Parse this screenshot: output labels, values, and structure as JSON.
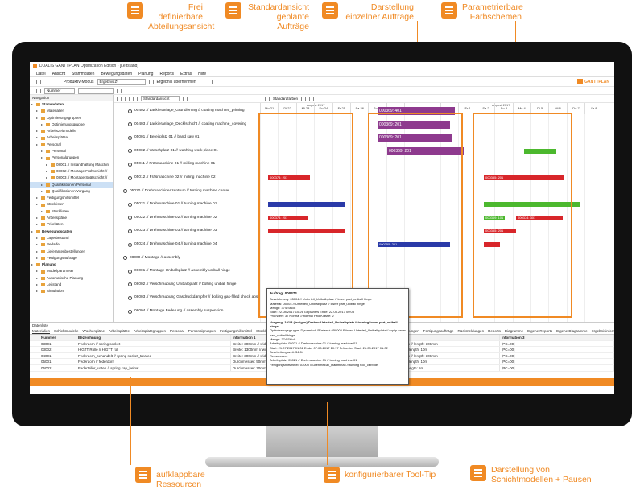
{
  "callouts": {
    "top": [
      {
        "id": "c1",
        "text": "Frei definierbare Abteilungsansicht",
        "icon": "list-icon"
      },
      {
        "id": "c2",
        "text": "Standardansicht geplante Aufträge",
        "icon": "gantt-icon"
      },
      {
        "id": "c3",
        "text": "Darstellung einzelner Aufträge",
        "icon": "order-icon"
      },
      {
        "id": "c4",
        "text": "Parametrierbare Farbschemen",
        "icon": "palette-icon"
      }
    ],
    "bottom": [
      {
        "id": "c5",
        "text": "aufklappbare Ressourcen",
        "icon": "list-icon"
      },
      {
        "id": "c6",
        "text": "konfigurierbarer Tool-Tip",
        "icon": "tooltip-icon"
      },
      {
        "id": "c7",
        "text": "Darstellung von Schichtmodellen + Pausen",
        "icon": "shift-icon"
      }
    ]
  },
  "app": {
    "title": "DUALIS GANTTPLAN Optimization Edition - [Leitstand]",
    "menu": [
      "Datei",
      "Ansicht",
      "Stammdaten",
      "Bewegungsdaten",
      "Planung",
      "Reports",
      "Extras",
      "Hilfe"
    ],
    "mode_label": "Produktiv-Modus",
    "result_value": "Ergebnis Z*",
    "apply_label": "Ergebnis übernehmen",
    "brand": "GANTTPLAN",
    "filter_value": "Nummer",
    "view_value": "Standardansicht",
    "color_value": "Standardfarben"
  },
  "nav": {
    "header": "Navigation",
    "items": [
      {
        "label": "Stammdaten",
        "level": 0,
        "bold": true
      },
      {
        "label": "Materialien",
        "level": 1
      },
      {
        "label": "Optimierungsgruppen",
        "level": 1
      },
      {
        "label": "Optimierungsgruppe",
        "level": 2
      },
      {
        "label": "Arbeitszeitmodelle",
        "level": 1
      },
      {
        "label": "Arbeitsplätze",
        "level": 1
      },
      {
        "label": "Personal",
        "level": 1
      },
      {
        "label": "Personal",
        "level": 2
      },
      {
        "label": "Personalgruppen",
        "level": 2
      },
      {
        "label": "08001 // Instandhaltung Maschin",
        "level": 3
      },
      {
        "label": "08002 // Montage Frühschicht //",
        "level": 3
      },
      {
        "label": "08003 // Montage Spätschicht //",
        "level": 3
      },
      {
        "label": "Qualifikationen Personal",
        "level": 2,
        "selected": true
      },
      {
        "label": "Qualifikationen Vorgang",
        "level": 2
      },
      {
        "label": "Fertigungshilfsmittel",
        "level": 1
      },
      {
        "label": "Stücklisten",
        "level": 1
      },
      {
        "label": "Stücklisten",
        "level": 2
      },
      {
        "label": "Arbeitspläne",
        "level": 1
      },
      {
        "label": "Prioritäten",
        "level": 1
      },
      {
        "label": "Bewegungsdaten",
        "level": 0,
        "bold": true
      },
      {
        "label": "Lagerbestand",
        "level": 1
      },
      {
        "label": "Bedarfe",
        "level": 1
      },
      {
        "label": "Lieferantenbestellungen",
        "level": 1
      },
      {
        "label": "Fertigungsaufträge",
        "level": 1
      },
      {
        "label": "Planung",
        "level": 0,
        "bold": true
      },
      {
        "label": "Modellparameter",
        "level": 1
      },
      {
        "label": "Automatische Planung",
        "level": 1
      },
      {
        "label": "Leitstand",
        "level": 1
      },
      {
        "label": "Simulation",
        "level": 1
      }
    ]
  },
  "resources": [
    {
      "label": "00402 // Lackieranlage_Grundierung // coating machine_priming",
      "group": false
    },
    {
      "label": "00403 // Lackieranlage_Decklschicht // coating machine_covering",
      "group": false
    },
    {
      "label": "05001 // Bereitplatz 01 // band saw 01",
      "group": false
    },
    {
      "label": "05002 // Waschplatz 01 // washing work place 01",
      "group": false
    },
    {
      "label": "05011 // Fräsmaschine 01 // milling machine 01",
      "group": false
    },
    {
      "label": "05012 // Fräsmaschine 02 // milling machine 02",
      "group": false
    },
    {
      "label": "05020 // Drehmaschinenzentrum // turning machine center",
      "group": true
    },
    {
      "label": "05021 // Drehmaschine 01 // turning machine 01",
      "group": false
    },
    {
      "label": "05022 // Drehmaschine 02 // turning machine 02",
      "group": false
    },
    {
      "label": "05023 // Drehmaschine 03 // turning machine 03",
      "group": false
    },
    {
      "label": "05024 // Drehmaschine 04 // turning machine 04",
      "group": false
    },
    {
      "label": "08000 // Montage // assembly",
      "group": true
    },
    {
      "label": "08001 // Montage Unibalbplatz // assembly uniball hinge",
      "group": false
    },
    {
      "label": "08002 // Verschraubung Unibalbplatz // bolting uniball hinge",
      "group": false
    },
    {
      "label": "08003 // Verschraubung Gasdruckdämpfer // bolting gas-filled shock absorber",
      "group": false
    },
    {
      "label": "08004 // Montage Federung // assembly suspension",
      "group": false
    }
  ],
  "timeline": {
    "month": "August 2017",
    "days": [
      "Mo 21",
      "Di 22",
      "Mi 23",
      "Do 24",
      "Fr 25",
      "Sa 26",
      "So 27",
      "Mo 28",
      "Di 29",
      "Mi 30",
      "Do 31",
      "Fr 1",
      "Sa 2",
      "So 3",
      "Mo 4",
      "Di 5",
      "Mi 6",
      "Do 7",
      "Fr 8"
    ]
  },
  "orders": {
    "o1": "000369: 401",
    "o2": "000369: 201",
    "o3": "000369: 201",
    "o4": "000369: 201",
    "o5": "000374: 201",
    "o6": "000355: 201",
    "o7": "000355: 201",
    "o8": "000374: 201",
    "o9": "000369: 101",
    "o10": "000374: 301",
    "o11": "000355: 201",
    "o12": "0003",
    "o13": "000355: 201",
    "o14": "000374: 201",
    "o15": "000355: 201"
  },
  "tooltip": {
    "title": "Auftrag: 000374",
    "lines": [
      "Bezeichnung: 05004 // Unterteil_Unibalbplatz // lower part_uniball hinge",
      "Material: 05004 // Unterteil_Unibalbplatz // lower part_uniball hinge",
      "Menge: 374 Stück",
      "Start: 22.08.2017 10:26 Geplantes Ende: 22.08.2017 00:03",
      "Prio/Wert: 3 / Normal // normal Prio/Klasse: 2"
    ],
    "section": "Vorgang: 101/3 (fertigen) Drehen Unterteil_Unibalbplatz // turning lower part_uniball hinge",
    "lines2": [
      "Optimierungsgruppe: Dynamisch Rüsten + 05000 / Rüsten Unterteil_Unibalbplatz // equip lower part_uniball hinge",
      "Menge: 374 Stück",
      "Arbeitsplatz: 05021 // Drehmaschine 01 // turning machine 01",
      "Start: 21.07.2017 01:02 Ende: 07.08.2017 10:17 Frühester Start: 21.08.2017 01:02 Bearbeitungszeit: 34:04",
      "Ressourcen:",
      "Arbeitsplatz: 05021 // Drehmaschine 01 // turning machine 01",
      "Fertigungshilfsmittel: 03000 // Drehmeißel_Hartmetall // turning tool_carbide"
    ]
  },
  "detail": {
    "header": "Datenliste",
    "tabs": [
      "Materialien",
      "Schichtmodelle",
      "Wochenpläne",
      "Arbeitsplätze",
      "Arbeitsplatzgruppen",
      "Personal",
      "Personalgruppen",
      "Fertigungshilfsmittel",
      "Stücklisten",
      "Arbeitspläne",
      "Bedarfe",
      "Bestandsbuchungen",
      "Bestellungen",
      "Lieferantenbestellungen",
      "Fertigungsaufträge",
      "Rückmeldungen",
      "Reports",
      "Diagramme",
      "Eigene Reports",
      "Eigene Diagramme",
      "Ergebnisinformationen"
    ],
    "active_tab": "Materialien",
    "columns": [
      "",
      "Nummer",
      "Bezeichnung",
      "Information 1",
      "Information 2",
      "Information 3"
    ],
    "rows": [
      [
        "",
        "03001",
        "Federdorn // spring socket",
        "Breite: 300mm // width: 300mm",
        "Länge: 300mm // length: 300mm",
        "[PC=00]"
      ],
      [
        "",
        "03002",
        "HiGTT Rolle // HiGTT roll",
        "Breite: 1300mm // width: 1300mm",
        "Länge: 10m // length: 10m",
        "[PC=00]"
      ],
      [
        "",
        "04001",
        "Federdorn_behandelt // spring socket_treated",
        "Breite: 300mm // width: 300mm",
        "Länge: 300mm // length: 300mm",
        "[PC=00]"
      ],
      [
        "",
        "05001",
        "Federdorn // federdorn",
        "Durchmesser: 50mm // diameter: 50mm",
        "Länge: 10m // length: 10m",
        "[PC=00]"
      ],
      [
        "",
        "05002",
        "Federteller_unten // spring cap_below",
        "Durchmesser: 70mm // diameter: 70mm",
        "Länge: 5m // length: 5m",
        "[PC=00]"
      ]
    ]
  },
  "colors": {
    "accent": "#f08a24",
    "purple": "#8e3a8e",
    "red": "#d8262a",
    "green": "#4cb82e",
    "blue": "#2a3aa8"
  }
}
